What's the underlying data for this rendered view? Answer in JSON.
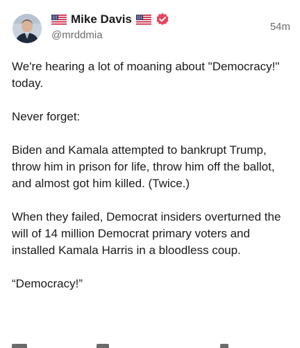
{
  "post": {
    "author": {
      "display_name": "Mike Davis",
      "handle": "@mrddmia",
      "flag_icon": "us-flag-icon",
      "verified_icon": "verified-badge-icon",
      "verified_color": "#e8445e"
    },
    "timestamp": "54m",
    "paragraphs": [
      "We're hearing a lot of moaning about \"Democracy!\" today.",
      "Never forget:",
      "Biden and Kamala attempted to bankrupt Trump, throw him in prison for life, throw him off the ballot, and almost got him killed. (Twice.)",
      "When they failed, Democrat insiders overturned the will of 14 million Democrat primary voters and installed Kamala Harris in a bloodless coup.",
      "“Democracy!”"
    ]
  }
}
